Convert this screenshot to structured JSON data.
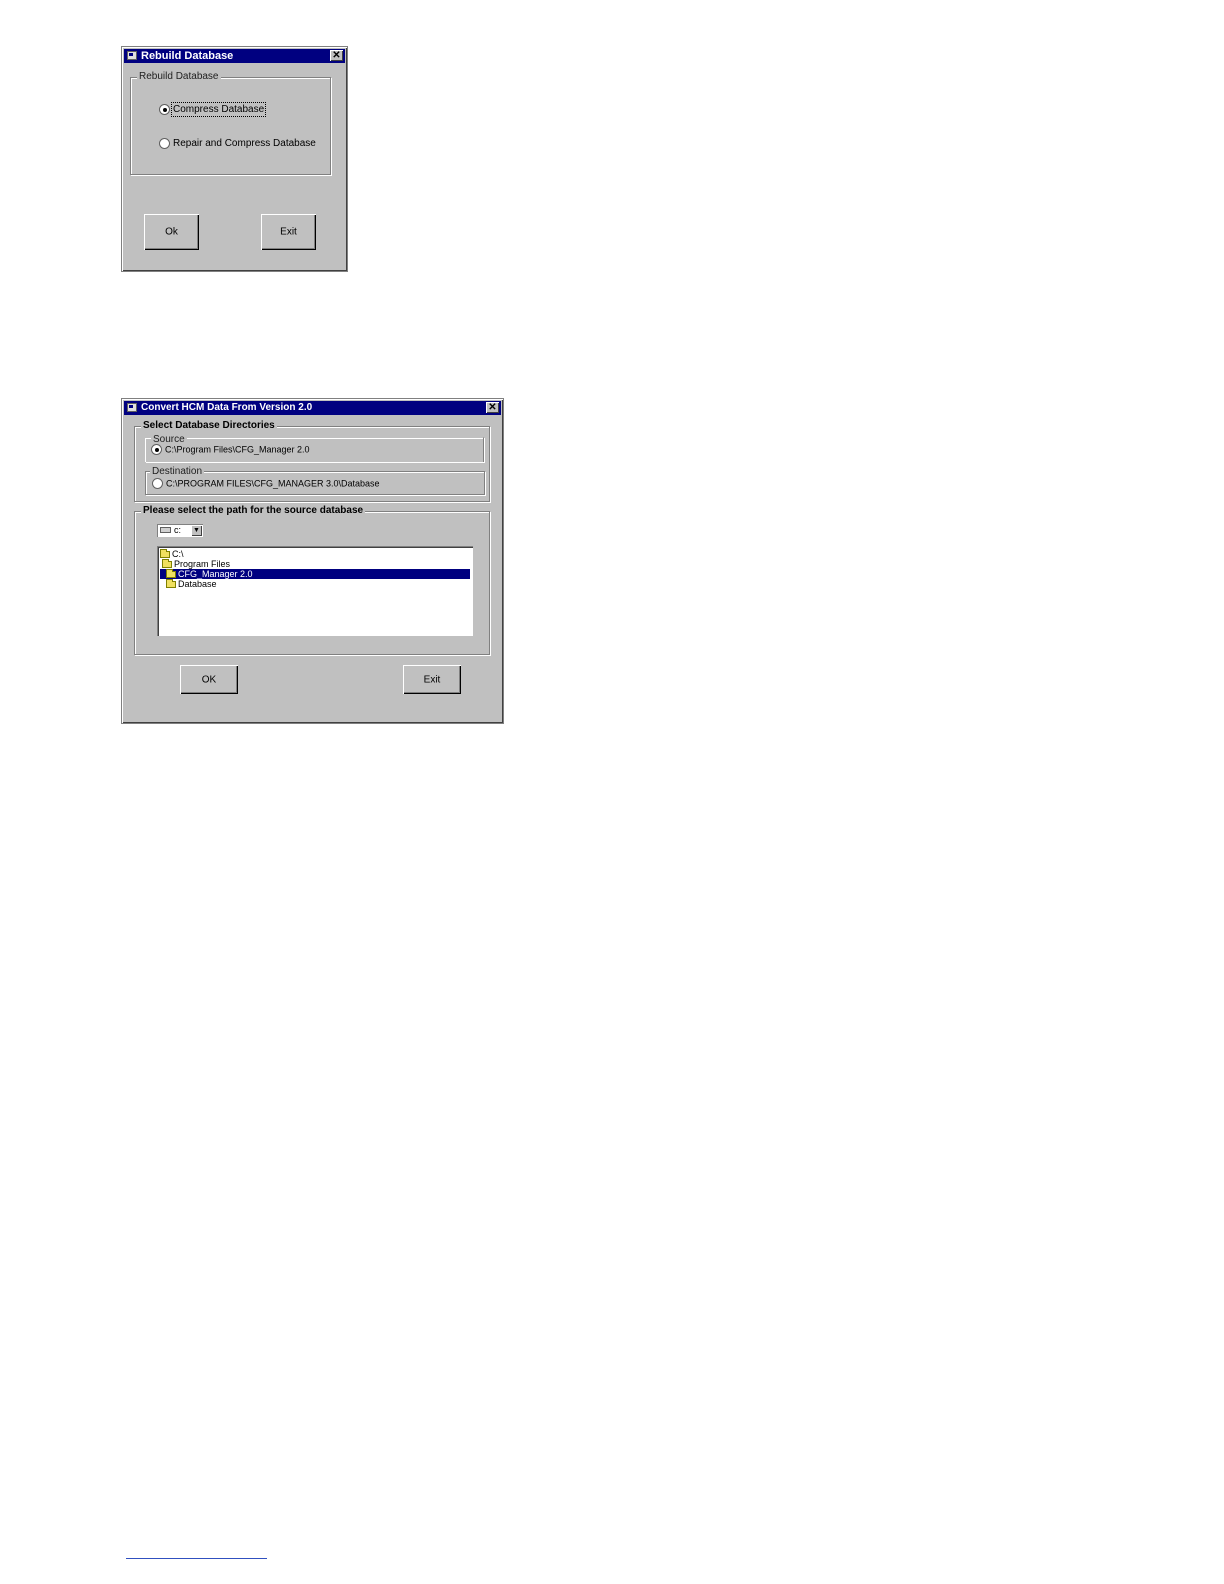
{
  "rebuild_dialog": {
    "title": "Rebuild Database",
    "close_label": "✕",
    "group_label": "Rebuild Database",
    "options": [
      {
        "label": "Compress Database",
        "checked": true
      },
      {
        "label": "Repair and Compress Database",
        "checked": false
      }
    ],
    "ok_label": "Ok",
    "exit_label": "Exit"
  },
  "convert_dialog": {
    "title": "Convert HCM Data From Version 2.0",
    "close_label": "✕",
    "dirs_group_label": "Select Database Directories",
    "source_label": "Source",
    "source_path": "C:\\Program Files\\CFG_Manager 2.0",
    "source_checked": true,
    "destination_label": "Destination",
    "destination_path": "C:\\PROGRAM FILES\\CFG_MANAGER 3.0\\Database",
    "destination_checked": false,
    "path_group_label": "Please select the path for the source database",
    "drive_value": "c:",
    "drive_arrow": "▼",
    "directories": [
      {
        "label": "C:\\",
        "selected": false
      },
      {
        "label": "Program Files",
        "selected": false
      },
      {
        "label": "CFG_Manager 2.0",
        "selected": true
      },
      {
        "label": "Database",
        "selected": false
      }
    ],
    "ok_label": "OK",
    "exit_label": "Exit"
  }
}
